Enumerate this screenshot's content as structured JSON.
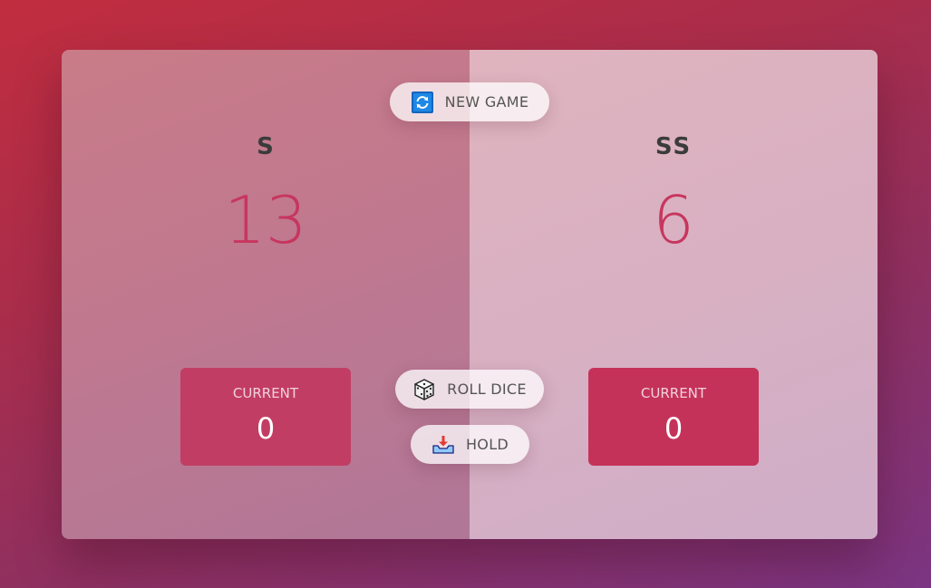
{
  "players": [
    {
      "name": "S",
      "score": "13",
      "current_label": "CURRENT",
      "current_score": "0"
    },
    {
      "name": "SS",
      "score": "6",
      "current_label": "CURRENT",
      "current_score": "0"
    }
  ],
  "buttons": {
    "new_game": {
      "label": "NEW GAME",
      "icon": "refresh-icon"
    },
    "roll_dice": {
      "label": "ROLL DICE",
      "icon": "dice-icon"
    },
    "hold": {
      "label": "HOLD",
      "icon": "download-tray-icon"
    }
  },
  "colors": {
    "score": "#c7365f",
    "current_box": "#c4325a"
  }
}
